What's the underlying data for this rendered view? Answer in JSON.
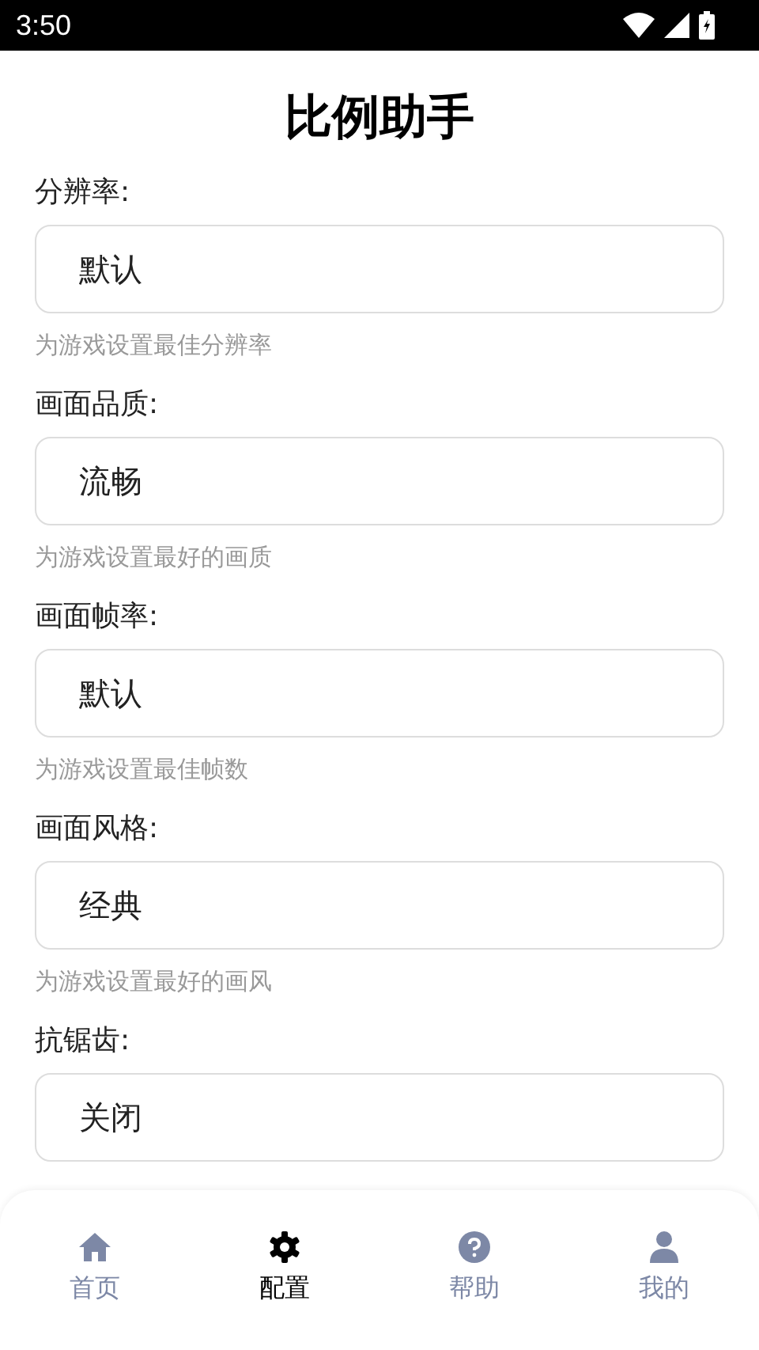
{
  "status_bar": {
    "time": "3:50"
  },
  "title": "比例助手",
  "settings": [
    {
      "label": "分辨率:",
      "value": "默认",
      "hint": "为游戏设置最佳分辨率"
    },
    {
      "label": "画面品质:",
      "value": "流畅",
      "hint": "为游戏设置最好的画质"
    },
    {
      "label": "画面帧率:",
      "value": "默认",
      "hint": "为游戏设置最佳帧数"
    },
    {
      "label": "画面风格:",
      "value": "经典",
      "hint": "为游戏设置最好的画风"
    },
    {
      "label": "抗锯齿:",
      "value": "关闭"
    }
  ],
  "nav": [
    {
      "kind": "home",
      "label": "首页",
      "selected": false
    },
    {
      "kind": "settings",
      "label": "配置",
      "selected": true
    },
    {
      "kind": "help",
      "label": "帮助",
      "selected": false
    },
    {
      "kind": "profile",
      "label": "我的",
      "selected": false
    }
  ]
}
